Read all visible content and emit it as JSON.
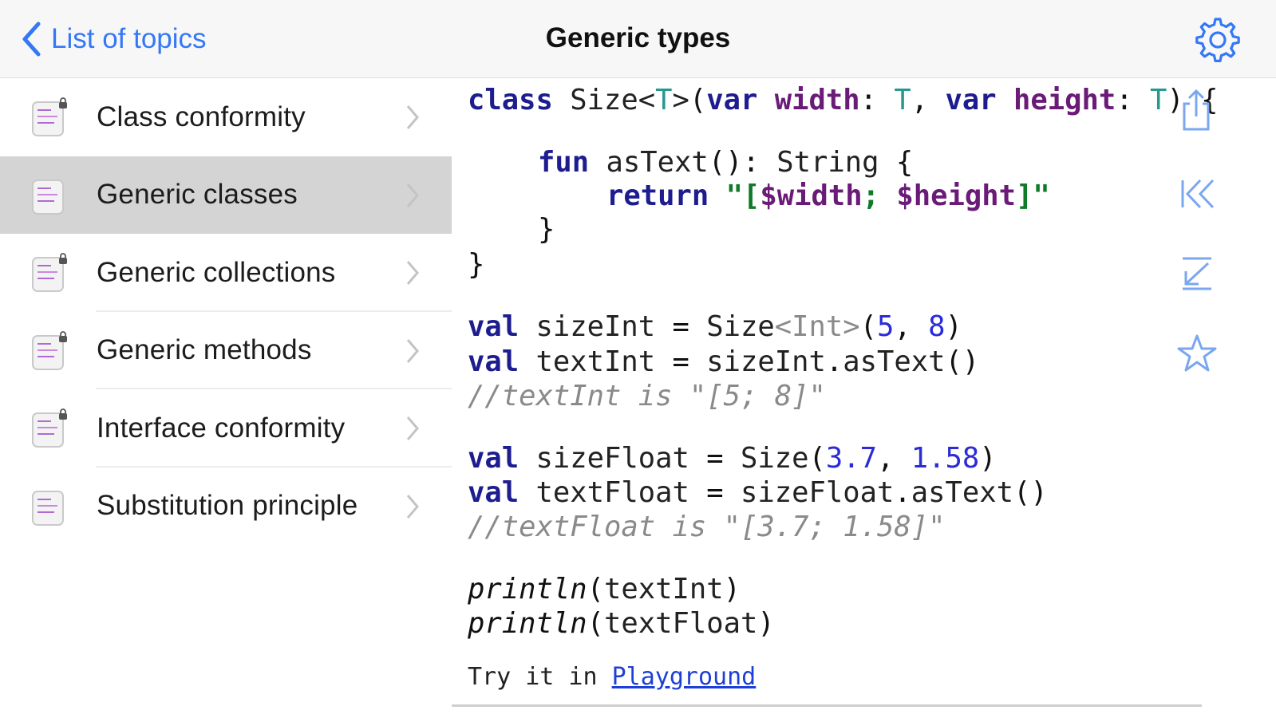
{
  "nav": {
    "back_label": "List of topics",
    "title": "Generic types",
    "accent_color": "#3478f6"
  },
  "sidebar": {
    "items": [
      {
        "label": "Class conformity",
        "icon": "lesson-locked-icon",
        "selected": false
      },
      {
        "label": "Generic classes",
        "icon": "lesson-icon",
        "selected": true
      },
      {
        "label": "Generic collections",
        "icon": "lesson-locked-icon",
        "selected": false
      },
      {
        "label": "Generic methods",
        "icon": "lesson-locked-icon",
        "selected": false
      },
      {
        "label": "Interface conformity",
        "icon": "lesson-locked-icon",
        "selected": false
      },
      {
        "label": "Substitution principle",
        "icon": "lesson-icon",
        "selected": false
      }
    ]
  },
  "code": {
    "lines": [
      "class Size<T>(var width: T, var height: T) {",
      "fun asText(): String {",
      "return \"[$width; $height]\"",
      "}",
      "}",
      "val sizeInt = Size<Int>(5, 8)",
      "val textInt = sizeInt.asText()",
      "//textInt is \"[5; 8]\"",
      "val sizeFloat = Size(3.7, 1.58)",
      "val textFloat = sizeFloat.asText()",
      "//textFloat is \"[3.7; 1.58]\"",
      "println(textInt)",
      "println(textFloat)"
    ],
    "try_prefix": "Try it in ",
    "playground_link": "Playground"
  },
  "toolbar": {
    "icons": [
      "share-icon",
      "jump-to-start-icon",
      "scroll-to-end-icon",
      "favorite-star-icon",
      "settings-gear-icon"
    ]
  }
}
